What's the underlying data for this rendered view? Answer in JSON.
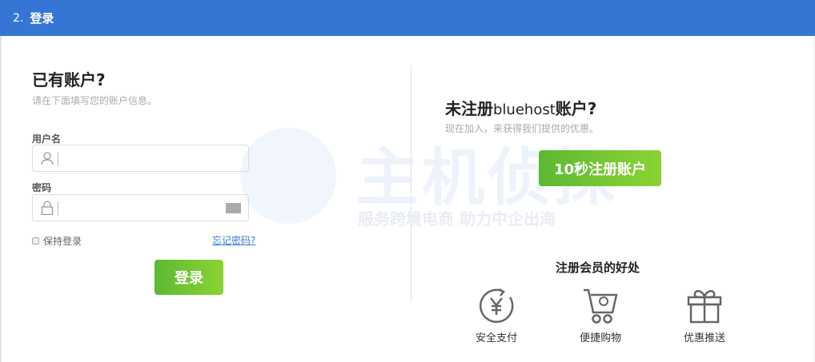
{
  "header": {
    "step": "2.",
    "title": "登录"
  },
  "login": {
    "title": "已有账户?",
    "subtitle": "请在下面填写您的账户信息。",
    "username_label": "用户名",
    "username_value": "",
    "password_label": "密码",
    "password_value": "",
    "remember_label": "保持登录",
    "forgot_link": "忘记密码?",
    "submit_label": "登录"
  },
  "register": {
    "title_a": "未注册",
    "title_b": "bluehost",
    "title_c": "账户?",
    "subtitle": "现在加入，来获得我们提供的优惠。",
    "button_label": "10秒注册账户",
    "benefits_title": "注册会员的好处",
    "benefits": [
      {
        "label": "安全支付",
        "icon": "yen-cycle-icon"
      },
      {
        "label": "便捷购物",
        "icon": "cart-icon"
      },
      {
        "label": "优惠推送",
        "icon": "gift-icon"
      }
    ]
  },
  "watermark": {
    "brand": "主机侦探",
    "slogan": "服务跨境电商 助力中企出海"
  },
  "colors": {
    "header": "#3576d4",
    "green": "#6cc332",
    "link": "#3a7bd5"
  }
}
